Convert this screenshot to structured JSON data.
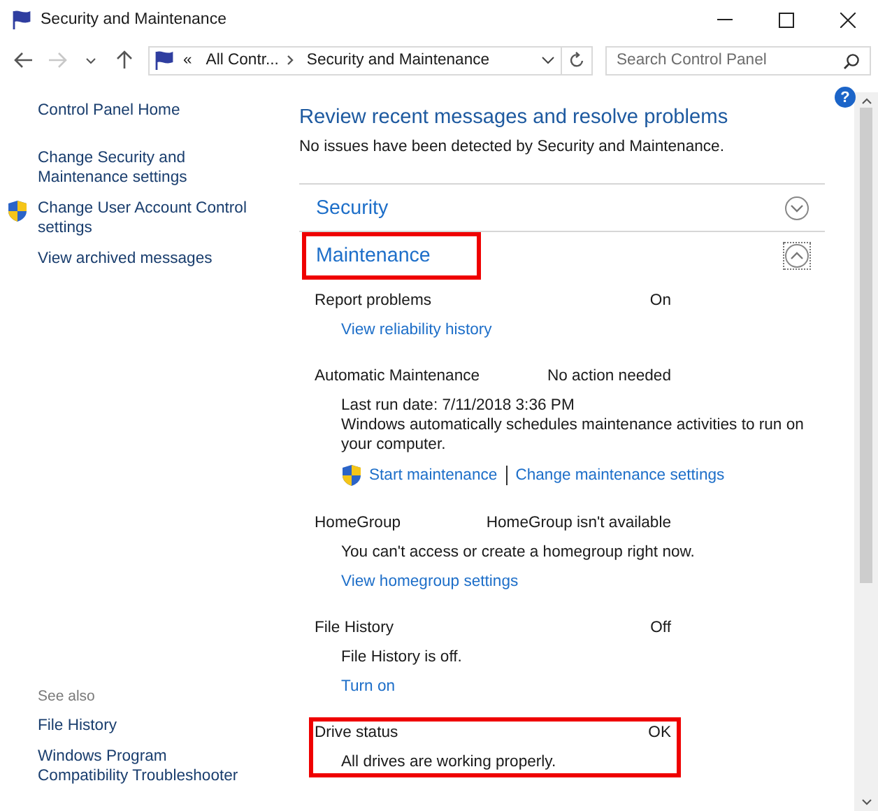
{
  "window": {
    "title": "Security and Maintenance"
  },
  "nav": {
    "back_disabled": false,
    "forward_disabled": true,
    "overflow": "«",
    "crumbs": [
      "All Contr...",
      "Security and Maintenance"
    ],
    "search": {
      "placeholder": "Search Control Panel"
    }
  },
  "help": "?",
  "sidebar": {
    "items": [
      {
        "text": "Control Panel Home",
        "shield": false
      },
      {
        "text": "Change Security and Maintenance settings",
        "shield": false
      },
      {
        "text": "Change User Account Control settings",
        "shield": true
      },
      {
        "text": "View archived messages",
        "shield": false
      }
    ],
    "see_also": {
      "title": "See also",
      "items": [
        "File History",
        "Windows Program Compatibility Troubleshooter"
      ]
    }
  },
  "main": {
    "heading": "Review recent messages and resolve problems",
    "subtitle": "No issues have been detected by Security and Maintenance.",
    "sections": [
      {
        "title": "Security",
        "expanded": false,
        "highlighted": false
      },
      {
        "title": "Maintenance",
        "expanded": true,
        "highlighted": true,
        "items": [
          {
            "label": "Report problems",
            "status": "On",
            "highlighted": false,
            "links": [
              {
                "text": "View reliability history",
                "shield": false
              }
            ]
          },
          {
            "label": "Automatic Maintenance",
            "status": "No action needed",
            "highlighted": false,
            "details": [
              "Last run date: 7/11/2018 3:36 PM",
              "Windows automatically schedules maintenance activities to run on your computer."
            ],
            "links": [
              {
                "text": "Start maintenance",
                "shield": true
              },
              {
                "text": "Change maintenance settings",
                "shield": false
              }
            ]
          },
          {
            "label": "HomeGroup",
            "status": "HomeGroup isn't available",
            "highlighted": false,
            "details": [
              "You can't access or create a homegroup right now."
            ],
            "links": [
              {
                "text": "View homegroup settings",
                "shield": false
              }
            ]
          },
          {
            "label": "File History",
            "status": "Off",
            "highlighted": false,
            "details": [
              "File History is off."
            ],
            "links": [
              {
                "text": "Turn on",
                "shield": false
              }
            ]
          },
          {
            "label": "Drive status",
            "status": "OK",
            "highlighted": true,
            "details": [
              "All drives are working properly."
            ]
          }
        ]
      }
    ]
  }
}
